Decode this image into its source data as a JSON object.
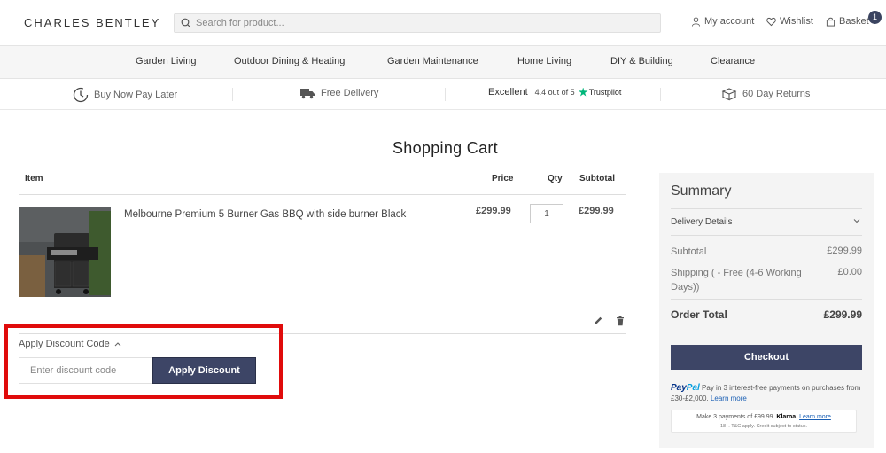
{
  "header": {
    "logo": "CHARLES BENTLEY",
    "search_placeholder": "Search for product...",
    "account": "My account",
    "wishlist": "Wishlist",
    "basket": "Basket",
    "basket_count": "1"
  },
  "nav": [
    "Garden Living",
    "Outdoor Dining & Heating",
    "Garden Maintenance",
    "Home Living",
    "DIY & Building",
    "Clearance"
  ],
  "usp": {
    "pay_later": "Buy Now Pay Later",
    "delivery": "Free Delivery",
    "rating_label": "Excellent",
    "rating_value": "4.4 out of 5",
    "trustpilot": "Trustpilot",
    "returns": "60 Day Returns"
  },
  "page_title": "Shopping Cart",
  "cart": {
    "headers": {
      "item": "Item",
      "price": "Price",
      "qty": "Qty",
      "subtotal": "Subtotal"
    },
    "items": [
      {
        "name": "Melbourne Premium 5 Burner Gas BBQ with side burner Black",
        "price": "£299.99",
        "qty": "1",
        "subtotal": "£299.99"
      }
    ]
  },
  "discount": {
    "toggle_label": "Apply Discount Code",
    "placeholder": "Enter discount code",
    "button": "Apply Discount"
  },
  "summary": {
    "title": "Summary",
    "delivery_details": "Delivery Details",
    "subtotal_label": "Subtotal",
    "subtotal_value": "£299.99",
    "shipping_label": "Shipping ( - Free (4-6 Working Days))",
    "shipping_value": "£0.00",
    "total_label": "Order Total",
    "total_value": "£299.99",
    "checkout": "Checkout",
    "paypal_pay": "Pay",
    "paypal_pal": "Pal",
    "paypal_text": "Pay in 3 interest-free payments on purchases from £30-£2,000.",
    "paypal_link": "Learn more",
    "klarna_text": "Make 3 payments of £99.99.",
    "klarna_logo": "Klarna.",
    "klarna_link": "Learn more",
    "klarna_sub": "18+. T&C apply. Credit subject to status."
  },
  "colors": {
    "primary_button": "#3d4566",
    "highlight": "#e00b0b",
    "trustpilot": "#00b67a"
  }
}
